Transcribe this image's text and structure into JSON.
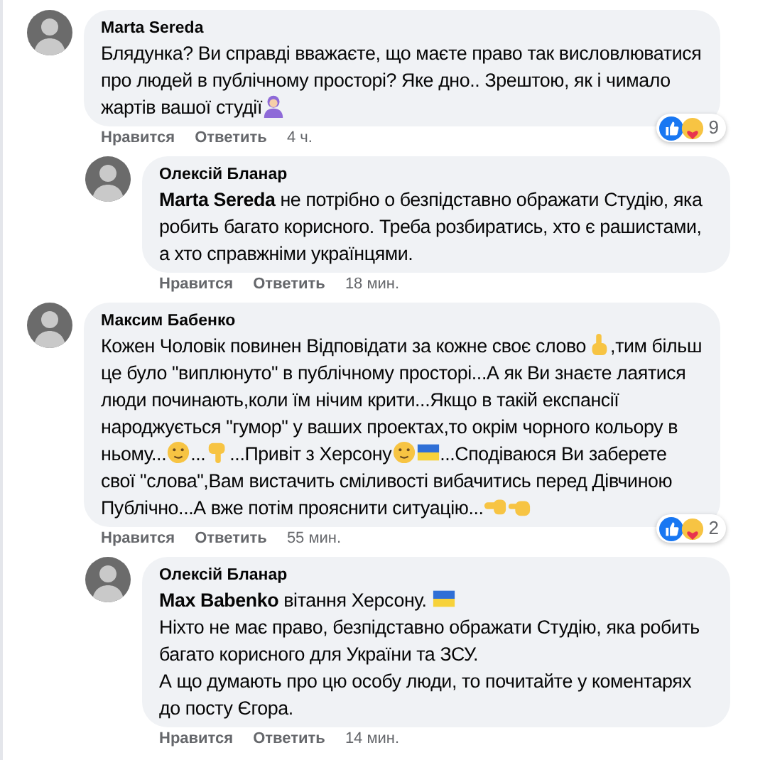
{
  "comments": [
    {
      "author": "Marta Sereda",
      "reply": false,
      "body": [
        {
          "kind": "text",
          "text": "Блядунка? Ви справді вважаєте, що маєте право так висловлюватися про людей в публічному просторі? Яке дно.. Зрештою, як і чимало жартів вашої студії"
        },
        {
          "kind": "person"
        }
      ],
      "like": "Нравится",
      "answer": "Ответить",
      "time": "4 ч.",
      "reactions": {
        "count": "9"
      }
    },
    {
      "author": "Олексій Бланар",
      "reply": true,
      "body": [
        {
          "kind": "text",
          "text": "**Marta Sereda** не потрібно о безпідставно ображати Студію, яка робить багато корисного. Треба розбиратись, хто є рашистами, а хто справжніми українцями."
        }
      ],
      "like": "Нравится",
      "answer": "Ответить",
      "time": "18 мин."
    },
    {
      "author": "Максим Бабенко",
      "reply": false,
      "body": [
        {
          "kind": "text",
          "text": "Кожен Чоловік повинен Відповідати за кожне своє слово"
        },
        {
          "kind": "hand_up"
        },
        {
          "kind": "text",
          "text": ",тим більш це було \"виплюнуто\" в публічному просторі...А як Ви знаєте лаятися люди починають,коли їм нічим крити...Якщо в такій експансії народжується \"гумор\" у ваших проектах,то окрім чорного кольору в ньому..."
        },
        {
          "kind": "face"
        },
        {
          "kind": "text",
          "text": "..."
        },
        {
          "kind": "thumbs_down"
        },
        {
          "kind": "text",
          "text": "...Привіт з Херсону"
        },
        {
          "kind": "face"
        },
        {
          "kind": "flag"
        },
        {
          "kind": "text",
          "text": "...Сподіваюся Ви заберете свої \"слова\",Вам вистачить сміливості вибачитись перед Дівчиною Публічно...А вже потім прояснити ситуацію..."
        },
        {
          "kind": "fist"
        },
        {
          "kind": "hand_left"
        }
      ],
      "like": "Нравится",
      "answer": "Ответить",
      "time": "55 мин.",
      "reactions": {
        "count": "2"
      }
    },
    {
      "author": "Олексій Бланар",
      "reply": true,
      "body": [
        {
          "kind": "text",
          "text": "**Max Babenko** вітання Херсону. "
        },
        {
          "kind": "flag"
        },
        {
          "kind": "break"
        },
        {
          "kind": "text",
          "text": "Ніхто не має право, безпідставно ображати Студію, яка робить багато корисного для України та ЗСУ."
        },
        {
          "kind": "break"
        },
        {
          "kind": "text",
          "text": "А що думають про цю особу люди, то почитайте у коментарях до посту Єгора."
        }
      ],
      "like": "Нравится",
      "answer": "Ответить",
      "time": "14 мин."
    }
  ]
}
